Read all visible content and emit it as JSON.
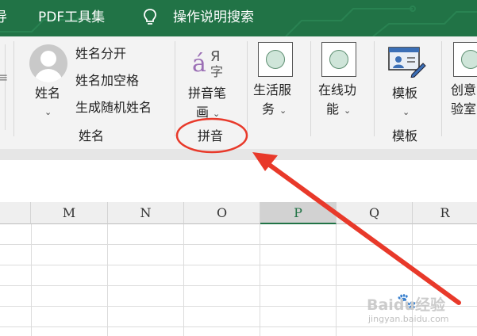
{
  "tabs": {
    "partial_left": "导",
    "pdf_tools": "PDF工具集",
    "search": "操作说明搜索"
  },
  "ribbon": {
    "name_group": {
      "name_button": "姓名",
      "split_name": "姓名分开",
      "name_add_space": "姓名加空格",
      "random_name": "生成随机姓名",
      "group_label": "姓名"
    },
    "pinyin_group": {
      "stroke_button_line1": "拼音笔",
      "stroke_button_line2": "画",
      "group_label": "拼音"
    },
    "life_services": {
      "line1": "生活服",
      "line2": "务"
    },
    "online_features": {
      "line1": "在线功",
      "line2": "能"
    },
    "template_group": {
      "button": "模板",
      "group_label": "模板"
    },
    "creative_partial": {
      "line1": "创意",
      "line2": "验室"
    }
  },
  "sheet": {
    "columns": [
      "M",
      "N",
      "O",
      "P",
      "Q",
      "R"
    ],
    "selected_column": "P"
  },
  "watermark": {
    "brand": "Baidu经验",
    "url": "jingyan.baidu.com"
  },
  "colors": {
    "accent": "#217346",
    "annotation": "#e8392a"
  }
}
